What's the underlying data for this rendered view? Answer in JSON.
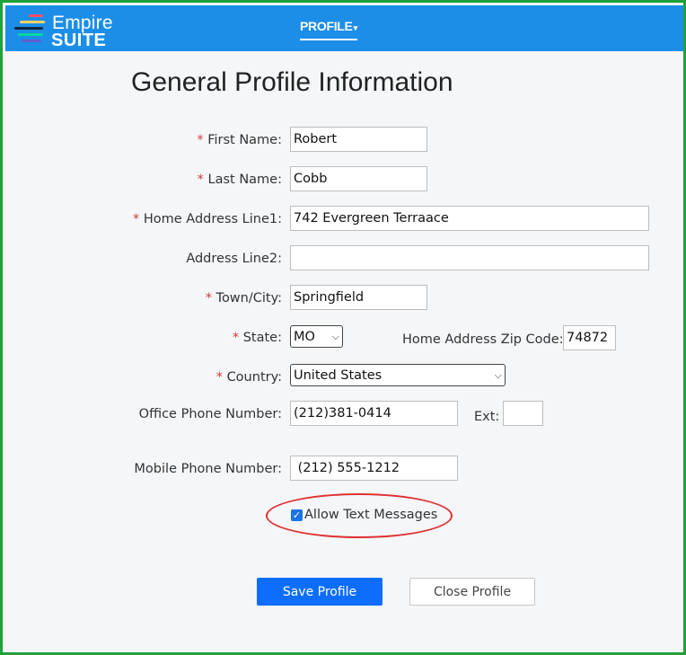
{
  "brand": {
    "name_line1": "Empire",
    "name_line2": "SUITE",
    "logo_colors": [
      "#ff4d6d",
      "#ffd166",
      "#06d6a0",
      "#118ab2",
      "#5e60ce"
    ]
  },
  "nav": {
    "profile_label": "PROFILE",
    "profile_caret": "▾"
  },
  "page": {
    "title": "General Profile Information"
  },
  "form": {
    "required_mark": "*",
    "first_name": {
      "label": "First Name:",
      "value": "Robert",
      "required": true
    },
    "last_name": {
      "label": "Last Name:",
      "value": "Cobb",
      "required": true
    },
    "address1": {
      "label": "Home Address Line1:",
      "value": "742 Evergreen Terraace",
      "required": true
    },
    "address2": {
      "label": "Address Line2:",
      "value": "",
      "required": false
    },
    "city": {
      "label": "Town/City:",
      "value": "Springfield",
      "required": true
    },
    "state": {
      "label": "State:",
      "value": "MO",
      "required": true
    },
    "zip": {
      "label": "Home Address Zip Code:",
      "value": "74872"
    },
    "country": {
      "label": "Country:",
      "value": "United States",
      "required": true
    },
    "office_phone": {
      "label": "Office Phone Number:",
      "value": "(212)381-0414"
    },
    "ext": {
      "label": "Ext:",
      "value": ""
    },
    "mobile_phone": {
      "label": "Mobile Phone Number:",
      "value": " (212) 555-1212"
    },
    "allow_text": {
      "label": "Allow Text Messages",
      "checked": true,
      "check_glyph": "✓"
    }
  },
  "buttons": {
    "save": "Save Profile",
    "close": "Close Profile"
  },
  "colors": {
    "topbar": "#1c8ee8",
    "frame_border": "#20a23a",
    "highlight_ellipse": "#e03030",
    "primary_button": "#0d6efd",
    "required": "#d43b3b"
  }
}
